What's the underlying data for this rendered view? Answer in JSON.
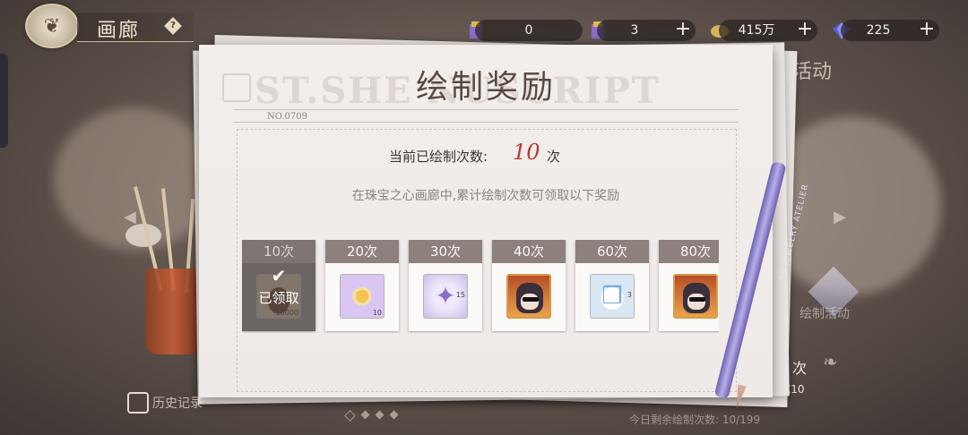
{
  "top_bar": {
    "page_title": "画廊",
    "help_glyph": "?",
    "resources": [
      {
        "icon": "ticket-icon",
        "value": "0",
        "has_plus": false
      },
      {
        "icon": "ticket-icon",
        "value": "3",
        "has_plus": true
      },
      {
        "icon": "coin-icon",
        "value": "415万",
        "has_plus": true
      },
      {
        "icon": "diamond-icon",
        "value": "225",
        "has_plus": true
      }
    ],
    "plus_glyph": "+"
  },
  "dialog": {
    "title": "绘制奖励",
    "header_ghost": "ST.SHE       NUSCRIPT",
    "form_no": "NO.0709",
    "count_label": "当前已绘制次数:",
    "count_value": "10",
    "count_unit": "次",
    "description": "在珠宝之心画廊中,累计绘制次数可领取以下奖励",
    "claimed_text": "已领取",
    "rewards": [
      {
        "label": "10次",
        "qty": "10000",
        "art": "ink-icon",
        "claimed": true
      },
      {
        "label": "20次",
        "qty": "10",
        "art": "sun-charm-icon",
        "claimed": false
      },
      {
        "label": "30次",
        "qty": "15",
        "art": "star-charm-icon",
        "claimed": false
      },
      {
        "label": "40次",
        "qty": "",
        "art": "portrait-icon",
        "claimed": false
      },
      {
        "label": "60次",
        "qty": "3",
        "art": "gift-box-icon",
        "claimed": false
      },
      {
        "label": "80次",
        "qty": "",
        "art": "portrait-icon",
        "claimed": false
      }
    ]
  },
  "background": {
    "activity_label": "活动",
    "draw_label": "绘制活动",
    "times_label": "次",
    "x10_label": "X10",
    "history_label": "历史记录",
    "remaining_label": "今日剩余绘制次数: 10/199",
    "pen_text": "BE JEWELRY ATELIER"
  },
  "colors": {
    "accent_red": "#b53a2d",
    "card_header": "#8c817c",
    "paper": "#f2eeec"
  }
}
